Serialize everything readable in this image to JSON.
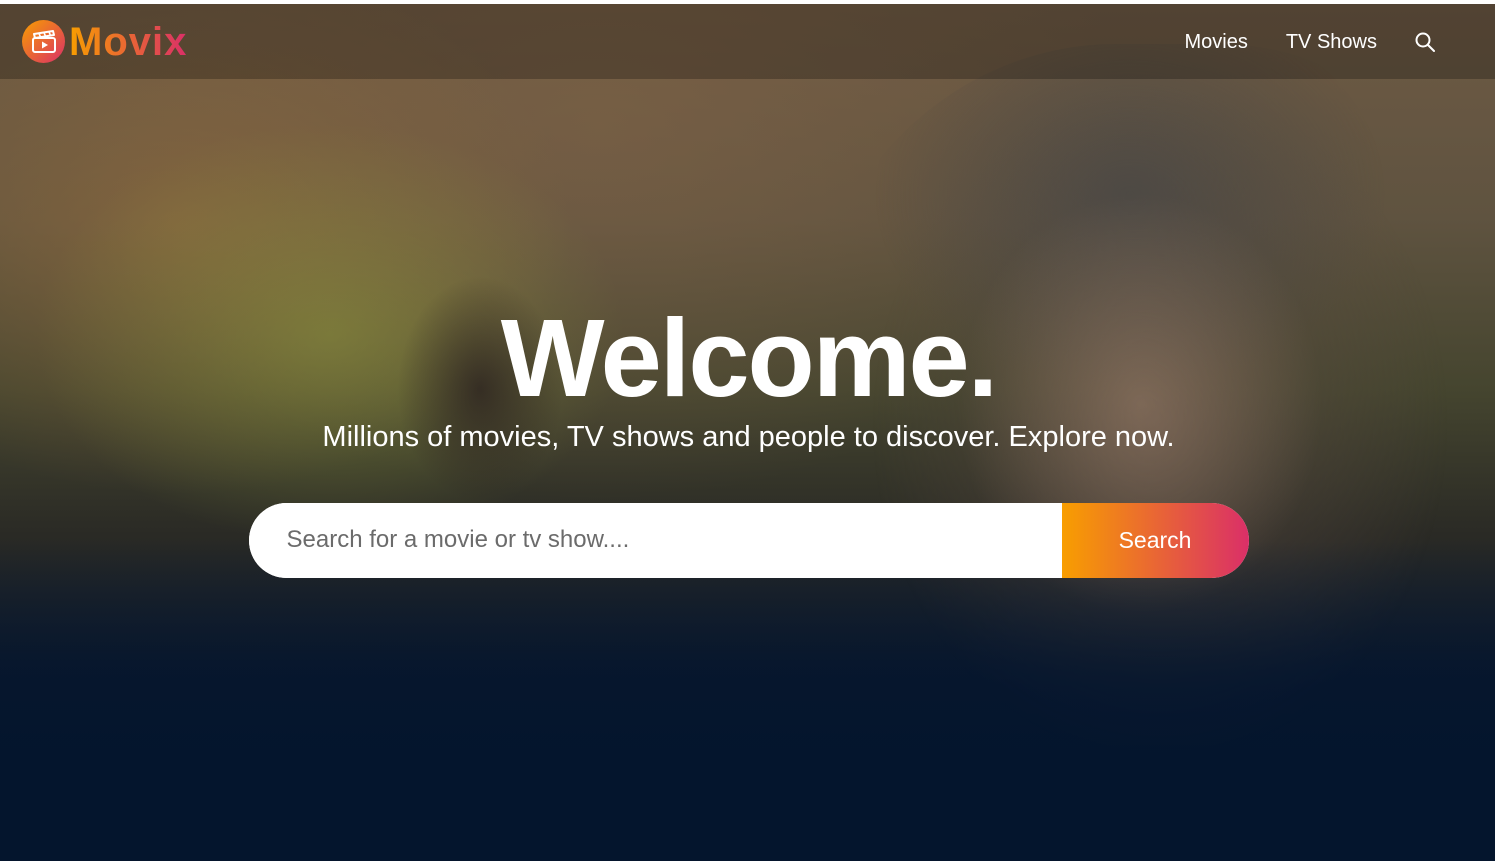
{
  "brand": {
    "name": "Movix",
    "logo_icon": "clapperboard-play-icon",
    "gradient_start": "#f89e00",
    "gradient_end": "#da2f68"
  },
  "nav": {
    "items": [
      {
        "label": "Movies"
      },
      {
        "label": "TV Shows"
      }
    ],
    "search_icon": "search-icon"
  },
  "hero": {
    "title": "Welcome.",
    "subtitle": "Millions of movies, TV shows and people to discover. Explore now.",
    "search": {
      "placeholder": "Search for a movie or tv show....",
      "value": "",
      "button_label": "Search"
    }
  },
  "colors": {
    "background": "#04152d",
    "text": "#ffffff"
  }
}
